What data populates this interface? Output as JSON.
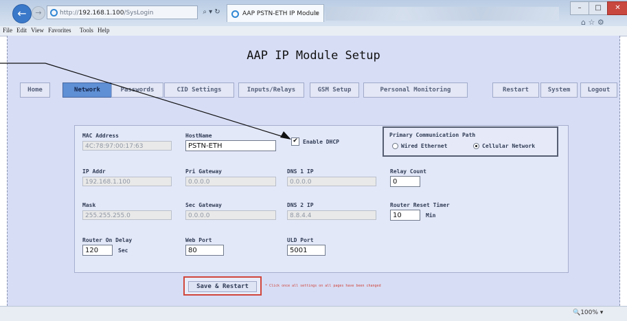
{
  "browser": {
    "address": {
      "prefix": "http://",
      "host": "192.168.1.100",
      "path": "/SysLogin"
    },
    "address_controls": "⌕ ▾ ↻",
    "tab_title": "AAP PSTN-ETH IP Module",
    "tab_close": "×",
    "back_icon": "←",
    "forward_icon": "→",
    "window_min": "–",
    "window_max": "□",
    "window_close": "✕",
    "toolbar_icons": "⌂ ☆ ⚙",
    "zoom": "🔍100%  ▾"
  },
  "menubar": [
    "File",
    "Edit",
    "View",
    "Favorites",
    "Tools",
    "Help"
  ],
  "page": {
    "title": "AAP IP Module Setup",
    "nav": [
      "Home",
      "Network",
      "Passwords",
      "CID Settings",
      "Inputs/Relays",
      "GSM Setup",
      "Personal Monitoring",
      "Restart",
      "System",
      "Logout"
    ],
    "active_nav": "Network"
  },
  "form": {
    "mac_address": {
      "label": "MAC Address",
      "value": "4C:78:97:00:17:63"
    },
    "hostname": {
      "label": "HostName",
      "value": "PSTN-ETH"
    },
    "enable_dhcp": {
      "label": "Enable DHCP",
      "checked": true,
      "mark": "✔"
    },
    "primary_path": {
      "label": "Primary Communication Path",
      "options": [
        "Wired Ethernet",
        "Cellular Network"
      ],
      "selected": "Cellular Network"
    },
    "ip_addr": {
      "label": "IP Addr",
      "value": "192.168.1.100"
    },
    "pri_gateway": {
      "label": "Pri Gateway",
      "value": "0.0.0.0"
    },
    "dns1": {
      "label": "DNS 1 IP",
      "value": "0.0.0.0"
    },
    "relay_count": {
      "label": "Relay Count",
      "value": "0"
    },
    "mask": {
      "label": "Mask",
      "value": "255.255.255.0"
    },
    "sec_gateway": {
      "label": "Sec Gateway",
      "value": "0.0.0.0"
    },
    "dns2": {
      "label": "DNS 2 IP",
      "value": "8.8.4.4"
    },
    "router_reset_timer": {
      "label": "Router Reset Timer",
      "value": "10",
      "unit": "Min"
    },
    "router_on_delay": {
      "label": "Router On Delay",
      "value": "120",
      "unit": "Sec"
    },
    "web_port": {
      "label": "Web Port",
      "value": "80"
    },
    "ulo_port": {
      "label": "ULD Port",
      "value": "5001"
    }
  },
  "save_button": "Save & Restart",
  "save_note": "* Click once all settings on all pages have been changed"
}
